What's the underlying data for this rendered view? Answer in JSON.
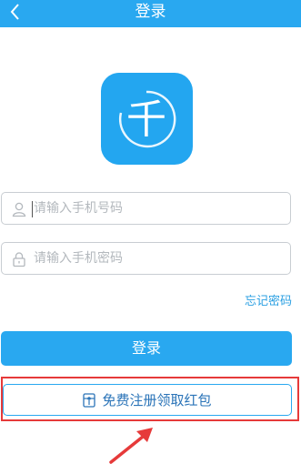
{
  "header": {
    "title": "登录",
    "back_icon": "chevron-left-icon"
  },
  "logo": {
    "glyph": "千",
    "icon": "app-logo"
  },
  "phone_field": {
    "placeholder": "请输入手机号码",
    "value": "",
    "icon": "user-icon"
  },
  "password_field": {
    "placeholder": "请输入手机密码",
    "value": "",
    "icon": "lock-icon"
  },
  "forgot_password": "忘记密码",
  "login_button": "登录",
  "register_button": {
    "label": "免费注册领取红包",
    "icon": "gift-icon"
  },
  "annotation": {
    "highlight_color": "#e63a3a",
    "arrow_icon": "arrow-up-right-icon"
  },
  "colors": {
    "primary": "#29a8f0",
    "link": "#2a9fe2",
    "border": "#c8cdd2"
  }
}
